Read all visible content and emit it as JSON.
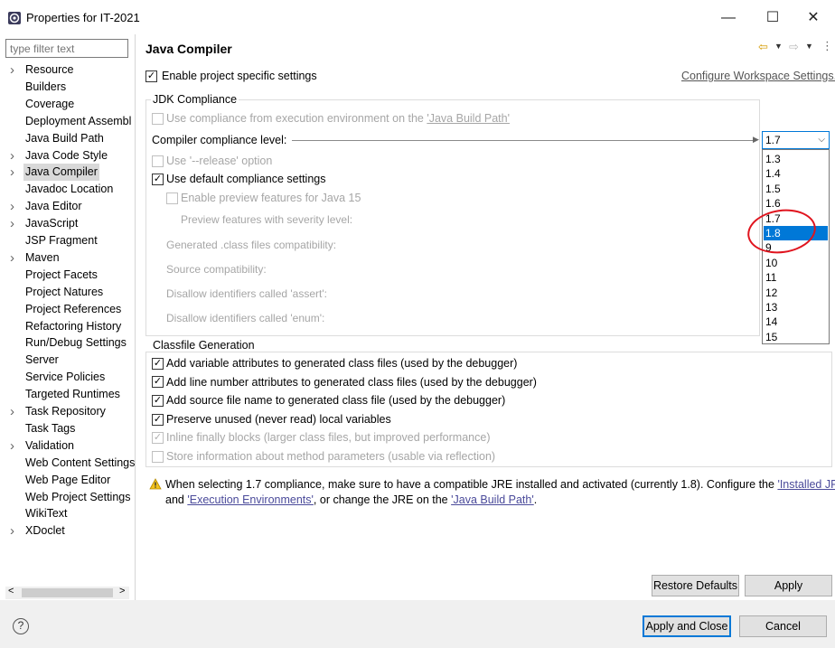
{
  "window": {
    "title": "Properties for IT-2021",
    "minimize_glyph": "—",
    "maximize_glyph": "☐",
    "close_glyph": "✕"
  },
  "sidebar": {
    "filter_placeholder": "type filter text",
    "items": [
      {
        "label": "Resource",
        "expandable": true
      },
      {
        "label": "Builders",
        "expandable": false
      },
      {
        "label": "Coverage",
        "expandable": false
      },
      {
        "label": "Deployment Assembl",
        "expandable": false
      },
      {
        "label": "Java Build Path",
        "expandable": false
      },
      {
        "label": "Java Code Style",
        "expandable": true
      },
      {
        "label": "Java Compiler",
        "expandable": true,
        "selected": true
      },
      {
        "label": "Javadoc Location",
        "expandable": false
      },
      {
        "label": "Java Editor",
        "expandable": true
      },
      {
        "label": "JavaScript",
        "expandable": true
      },
      {
        "label": "JSP Fragment",
        "expandable": false
      },
      {
        "label": "Maven",
        "expandable": true
      },
      {
        "label": "Project Facets",
        "expandable": false
      },
      {
        "label": "Project Natures",
        "expandable": false
      },
      {
        "label": "Project References",
        "expandable": false
      },
      {
        "label": "Refactoring History",
        "expandable": false
      },
      {
        "label": "Run/Debug Settings",
        "expandable": false
      },
      {
        "label": "Server",
        "expandable": false
      },
      {
        "label": "Service Policies",
        "expandable": false
      },
      {
        "label": "Targeted Runtimes",
        "expandable": false
      },
      {
        "label": "Task Repository",
        "expandable": true
      },
      {
        "label": "Task Tags",
        "expandable": false
      },
      {
        "label": "Validation",
        "expandable": true
      },
      {
        "label": "Web Content Settings",
        "expandable": false
      },
      {
        "label": "Web Page Editor",
        "expandable": false
      },
      {
        "label": "Web Project Settings",
        "expandable": false
      },
      {
        "label": "WikiText",
        "expandable": false
      },
      {
        "label": "XDoclet",
        "expandable": true
      }
    ],
    "scroll_left": "<",
    "scroll_right": ">"
  },
  "page": {
    "title": "Java Compiler",
    "enable_project_specific": "Enable project specific settings",
    "configure_workspace": "Configure Workspace Settings...",
    "jdk_group": "JDK Compliance",
    "use_compliance_prefix": "Use compliance from execution environment on the ",
    "use_compliance_link": "'Java Build Path'",
    "compliance_level_label": "Compiler compliance level:",
    "compliance_value": "1.7",
    "release_option": "Use '--release' option",
    "use_default": "Use default compliance settings",
    "enable_preview": "Enable preview features for Java 15",
    "preview_severity": "Preview features with severity level:",
    "generated_compat": "Generated .class files compatibility:",
    "source_compat": "Source compatibility:",
    "disallow_assert": "Disallow identifiers called 'assert':",
    "disallow_enum": "Disallow identifiers called 'enum':",
    "dropdown_options": [
      "1.3",
      "1.4",
      "1.5",
      "1.6",
      "1.7",
      "1.8",
      "9",
      "10",
      "11",
      "12",
      "13",
      "14",
      "15"
    ],
    "dropdown_selected": "1.8",
    "classfile_group": "Classfile Generation",
    "cf_var_attrs": "Add variable attributes to generated class files (used by the debugger)",
    "cf_line_attrs": "Add line number attributes to generated class files (used by the debugger)",
    "cf_source_name": "Add source file name to generated class file (used by the debugger)",
    "cf_preserve": "Preserve unused (never read) local variables",
    "cf_inline": "Inline finally blocks (larger class files, but improved performance)",
    "cf_store_params": "Store information about method parameters (usable via reflection)",
    "warning_1": "When selecting 1.7 compliance, make sure to have a compatible JRE installed and activated (currently 1.8). Configure the ",
    "warning_link_jres": "'Installed JREs'",
    "warning_and": "and ",
    "warning_link_ee": "'Execution Environments'",
    "warning_2": ", or change the JRE on the ",
    "warning_link_jbp": "'Java Build Path'",
    "warning_end": ".",
    "restore_defaults": "Restore Defaults",
    "apply": "Apply"
  },
  "footer": {
    "help_glyph": "?",
    "apply_close": "Apply and Close",
    "cancel": "Cancel"
  },
  "colors": {
    "accent": "#0078d7",
    "highlight_circle": "#e0141e",
    "warning": "#e8b400"
  }
}
